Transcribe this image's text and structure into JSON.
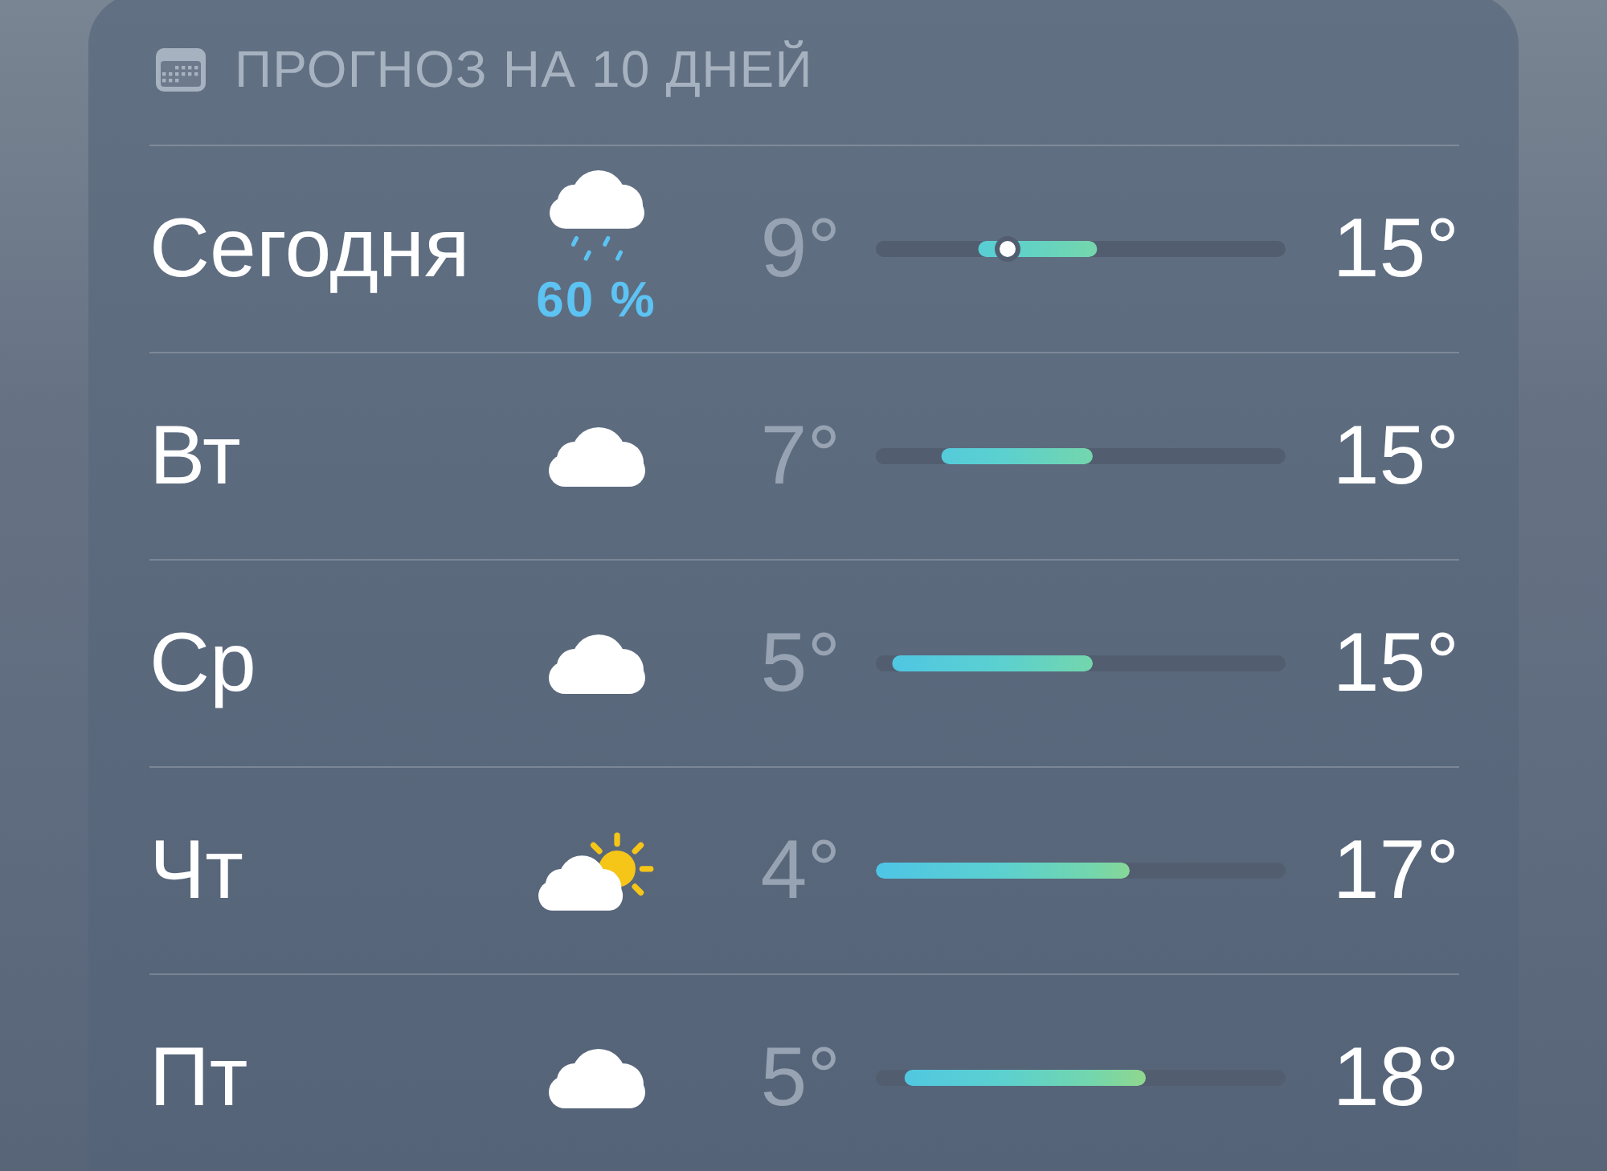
{
  "header": {
    "title": "ПРОГНОЗ НА 10 ДНЕЙ"
  },
  "days": [
    {
      "day": "Сегодня",
      "kind": "rain",
      "precipitation": "60 %",
      "low": "9°",
      "high": "15°",
      "range": {
        "start": {
          "level": 0.25
        },
        "end": {
          "level": 0.54
        }
      },
      "current": {
        "level": 0.32
      }
    },
    {
      "day": "Вт",
      "kind": "cloud",
      "low": "7°",
      "high": "15°",
      "range": {
        "start": {
          "level": 0.16
        },
        "end": {
          "level": 0.53
        }
      }
    },
    {
      "day": "Ср",
      "kind": "cloud",
      "low": "5°",
      "high": "15°",
      "range": {
        "start": {
          "level": 0.04
        },
        "end": {
          "level": 0.53
        }
      }
    },
    {
      "day": "Чт",
      "kind": "partly_sunny",
      "low": "4°",
      "high": "17°",
      "range": {
        "end": {
          "level": 0.62
        }
      }
    },
    {
      "day": "Пт",
      "kind": "cloud",
      "low": "5°",
      "high": "18°",
      "range": {
        "start": {
          "level": 0.07
        },
        "end": {
          "level": 0.66
        }
      }
    }
  ]
}
